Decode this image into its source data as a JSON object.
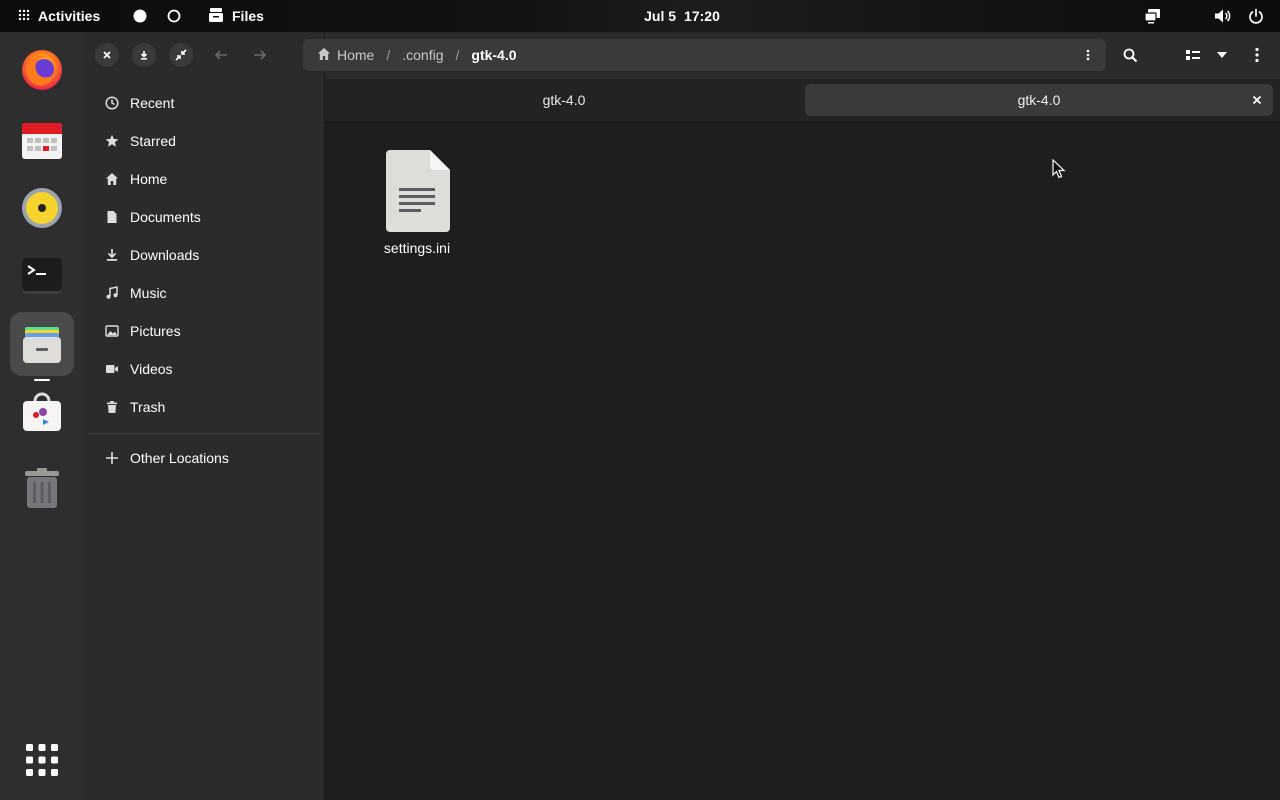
{
  "topbar": {
    "activities_label": "Activities",
    "app_name": "Files",
    "date": "Jul 5",
    "time": "17:20"
  },
  "dock": {
    "items": [
      "firefox",
      "calendar",
      "rhythmbox",
      "terminal",
      "files",
      "software",
      "trash"
    ],
    "active": "files"
  },
  "sidebar": {
    "items": [
      {
        "label": "Recent",
        "icon": "clock-icon"
      },
      {
        "label": "Starred",
        "icon": "star-icon"
      },
      {
        "label": "Home",
        "icon": "home-icon"
      },
      {
        "label": "Documents",
        "icon": "document-icon"
      },
      {
        "label": "Downloads",
        "icon": "download-icon"
      },
      {
        "label": "Music",
        "icon": "music-icon"
      },
      {
        "label": "Pictures",
        "icon": "picture-icon"
      },
      {
        "label": "Videos",
        "icon": "video-icon"
      },
      {
        "label": "Trash",
        "icon": "trash-icon"
      }
    ],
    "other_locations": "Other Locations"
  },
  "pathbar": {
    "crumbs": [
      "Home",
      ".config",
      "gtk-4.0"
    ],
    "separator": "/"
  },
  "tabs": [
    {
      "label": "gtk-4.0",
      "active": false
    },
    {
      "label": "gtk-4.0",
      "active": true
    }
  ],
  "files": [
    {
      "name": "settings.ini",
      "type": "text-document"
    }
  ],
  "colors": {
    "background": "#1e1e1e",
    "sidebar": "#2b2b2b",
    "dock": "#2e2e2e",
    "accent_yellow": "#f6d32d"
  }
}
